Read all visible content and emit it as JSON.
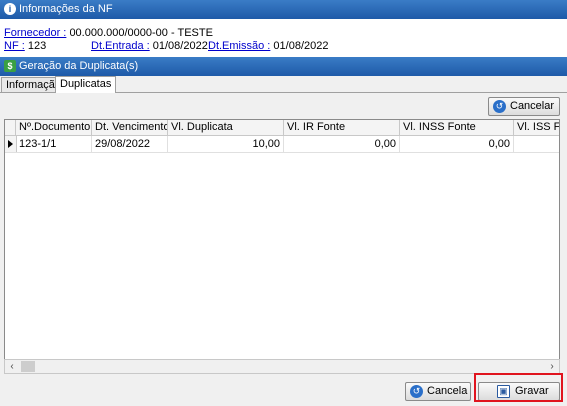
{
  "info_panel": {
    "title": "Informações da NF",
    "fornecedor_label": "Fornecedor :",
    "fornecedor_value": "00.000.000/0000-00 - TESTE",
    "nf_label": "NF :",
    "nf_value": "123",
    "dt_entrada_label": "Dt.Entrada :",
    "dt_entrada_value": "01/08/2022",
    "dt_emissao_label": "Dt.Emissão :",
    "dt_emissao_value": "01/08/2022"
  },
  "dup_panel": {
    "title": "Geração da Duplicata(s)"
  },
  "tabs": [
    {
      "label": "Informação",
      "active": false
    },
    {
      "label": "Duplicatas",
      "active": true
    }
  ],
  "cancelar_button": {
    "label": "Cancelar"
  },
  "grid": {
    "columns": [
      "Nº.Documento",
      "Dt. Vencimento",
      "Vl. Duplicata",
      "Vl. IR Fonte",
      "Vl. INSS Fonte",
      "Vl. ISS Font"
    ],
    "rows": [
      {
        "documento": "123-1/1",
        "vencimento": "29/08/2022",
        "duplicata": "10,00",
        "ir_fonte": "0,00",
        "inss_fonte": "0,00",
        "iss_fonte": ""
      }
    ]
  },
  "scrollbar": {
    "left_arrow": "‹",
    "right_arrow": "›"
  },
  "footer": {
    "cancela_label": "Cancela",
    "gravar_label": "Gravar"
  },
  "icons": {
    "info": "i",
    "money": "$",
    "cancel": "↺",
    "save": "▣"
  },
  "colors": {
    "title_bar": "#1e5aa8",
    "highlight": "#e0141e",
    "link": "#0000cc"
  }
}
